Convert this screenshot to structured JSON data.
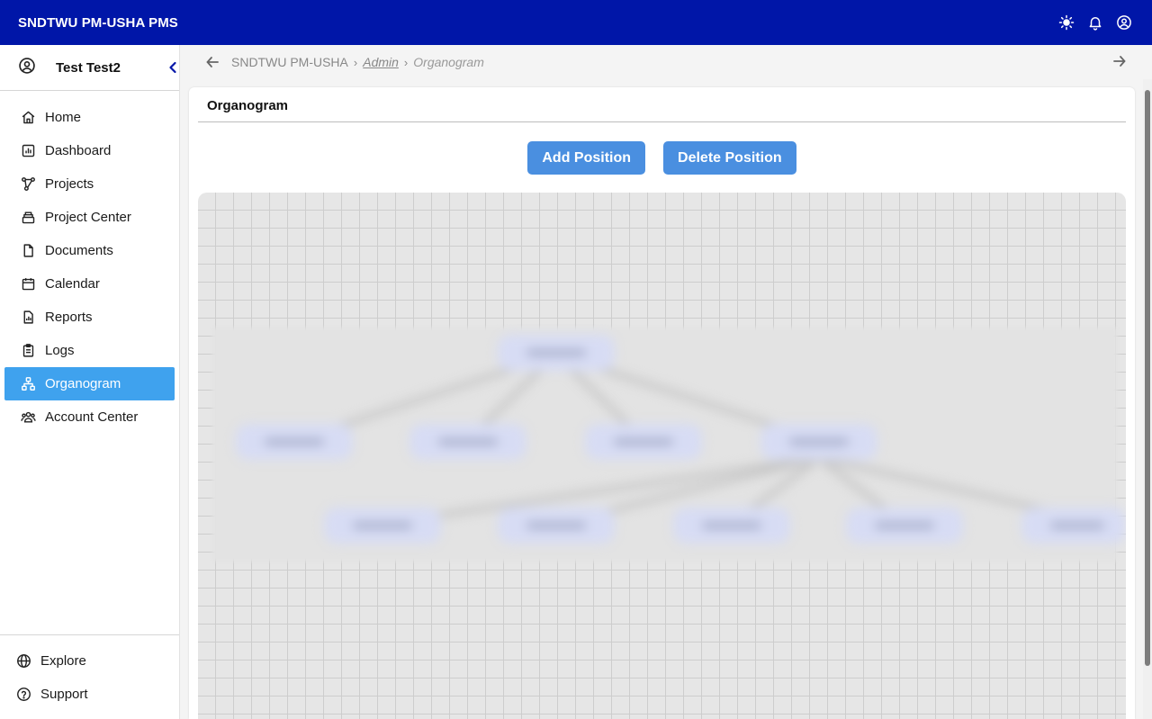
{
  "app": {
    "title": "SNDTWU PM-USHA PMS",
    "accent_color": "#0016a8",
    "active_color": "#3fa2ee",
    "button_color": "#4a8fe0"
  },
  "topbar": {
    "icons": [
      "sun-icon",
      "bell-icon",
      "user-circle-icon"
    ]
  },
  "sidebar": {
    "user_name": "Test Test2",
    "items": [
      {
        "label": "Home",
        "icon": "home-icon"
      },
      {
        "label": "Dashboard",
        "icon": "dashboard-icon"
      },
      {
        "label": "Projects",
        "icon": "projects-icon"
      },
      {
        "label": "Project Center",
        "icon": "project-center-icon"
      },
      {
        "label": "Documents",
        "icon": "document-icon"
      },
      {
        "label": "Calendar",
        "icon": "calendar-icon"
      },
      {
        "label": "Reports",
        "icon": "reports-icon"
      },
      {
        "label": "Logs",
        "icon": "logs-icon"
      },
      {
        "label": "Organogram",
        "icon": "organogram-icon",
        "active": true
      },
      {
        "label": "Account Center",
        "icon": "users-icon"
      }
    ],
    "bottom_items": [
      {
        "label": "Explore",
        "icon": "globe-icon"
      },
      {
        "label": "Support",
        "icon": "help-icon"
      }
    ]
  },
  "breadcrumb": {
    "items": [
      "SNDTWU PM-USHA",
      "Admin",
      "Organogram"
    ],
    "separator": "›"
  },
  "main": {
    "title": "Organogram",
    "add_button": "Add Position",
    "delete_button": "Delete Position"
  }
}
